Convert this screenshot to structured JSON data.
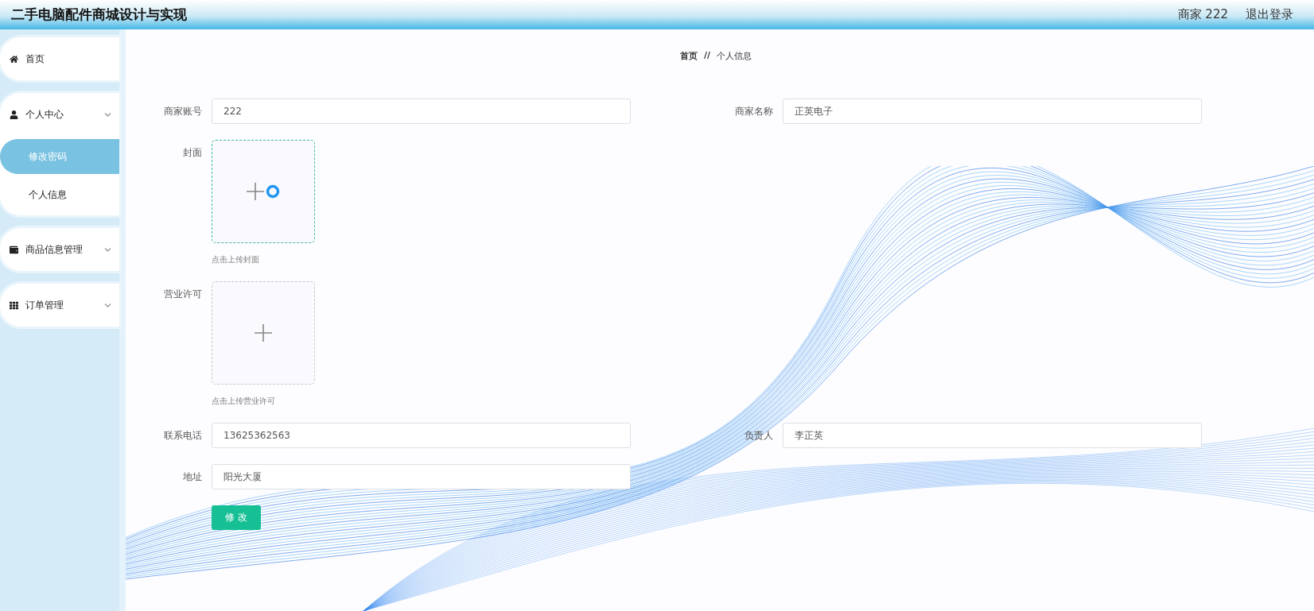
{
  "header": {
    "title": "二手电脑配件商城设计与实现",
    "user": "商家 222",
    "logout": "退出登录"
  },
  "sidebar": {
    "items": [
      {
        "label": "首页",
        "kind": "link"
      },
      {
        "label": "个人中心",
        "kind": "group",
        "expanded": true,
        "children": [
          {
            "label": "修改密码",
            "selected": true
          },
          {
            "label": "个人信息",
            "selected": false
          }
        ]
      },
      {
        "label": "商品信息管理",
        "kind": "group"
      },
      {
        "label": "订单管理",
        "kind": "group"
      }
    ]
  },
  "breadcrumb": {
    "home": "首页",
    "separator": "//",
    "current": "个人信息"
  },
  "form": {
    "rows": [
      {
        "kind": "pair",
        "fields": [
          {
            "label": "商家账号",
            "value": "222"
          },
          {
            "label": "商家名称",
            "value": "正英电子"
          }
        ]
      },
      {
        "kind": "upload",
        "label": "封面",
        "hint": "点击上传封面",
        "highlighted": true,
        "loading": true
      },
      {
        "kind": "upload",
        "label": "营业许可",
        "hint": "点击上传营业许可",
        "highlighted": false,
        "loading": false
      },
      {
        "kind": "pair",
        "fields": [
          {
            "label": "联系电话",
            "value": "13625362563"
          },
          {
            "label": "负责人",
            "value": "李正英"
          }
        ]
      },
      {
        "kind": "single",
        "fields": [
          {
            "label": "地址",
            "value": "阳光大厦"
          }
        ]
      }
    ],
    "submit": "修 改"
  }
}
